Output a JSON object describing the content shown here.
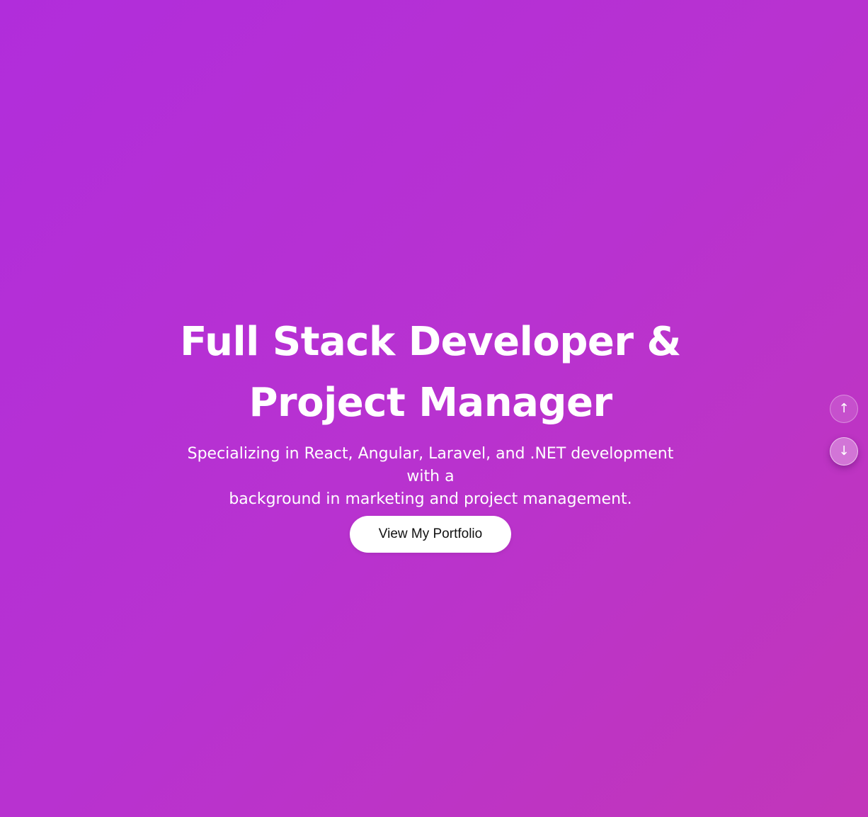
{
  "hero": {
    "title_line1": "Full Stack Developer &",
    "title_line2": "Project Manager",
    "subtitle_line1": "Specializing in React, Angular, Laravel, and .NET development with a",
    "subtitle_line2": "background in marketing and project management.",
    "cta_label": "View My Portfolio"
  },
  "side_nav": {
    "up_icon": "↑",
    "down_icon": "↓",
    "up_icon_name": "arrow-up-icon",
    "down_icon_name": "arrow-down-icon"
  },
  "colors": {
    "gradient_start": "#b12ddb",
    "gradient_end": "#c236b9",
    "text": "#ffffff",
    "button_bg": "#ffffff",
    "button_text": "#111111"
  }
}
